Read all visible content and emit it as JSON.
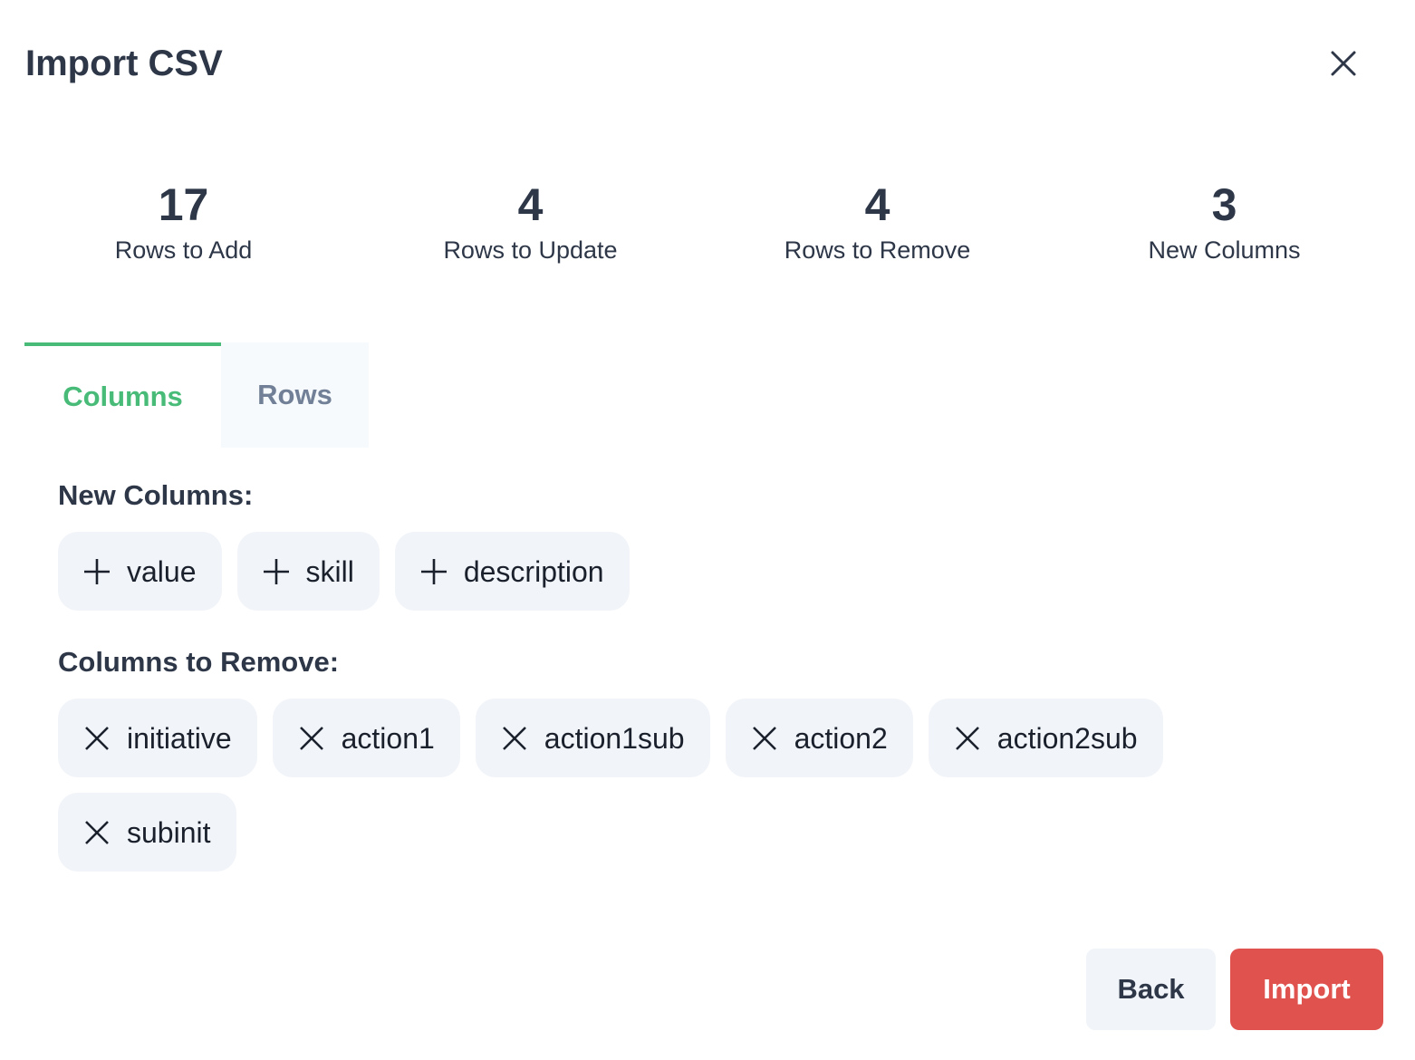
{
  "modal": {
    "title": "Import CSV"
  },
  "stats": [
    {
      "value": "17",
      "label": "Rows to Add"
    },
    {
      "value": "4",
      "label": "Rows to Update"
    },
    {
      "value": "4",
      "label": "Rows to Remove"
    },
    {
      "value": "3",
      "label": "New Columns"
    }
  ],
  "tabs": [
    {
      "label": "Columns",
      "active": true
    },
    {
      "label": "Rows",
      "active": false
    }
  ],
  "new_columns": {
    "heading": "New Columns:",
    "icon": "plus-icon",
    "items": [
      "value",
      "skill",
      "description"
    ]
  },
  "columns_to_remove": {
    "heading": "Columns to Remove:",
    "icon": "x-icon",
    "items": [
      "initiative",
      "action1",
      "action1sub",
      "action2",
      "action2sub",
      "subinit"
    ]
  },
  "footer": {
    "back_label": "Back",
    "import_label": "Import"
  },
  "colors": {
    "accent": "#48bb78",
    "danger": "#e0524e",
    "chip_bg": "#f1f4f8",
    "text": "#2d3748"
  }
}
